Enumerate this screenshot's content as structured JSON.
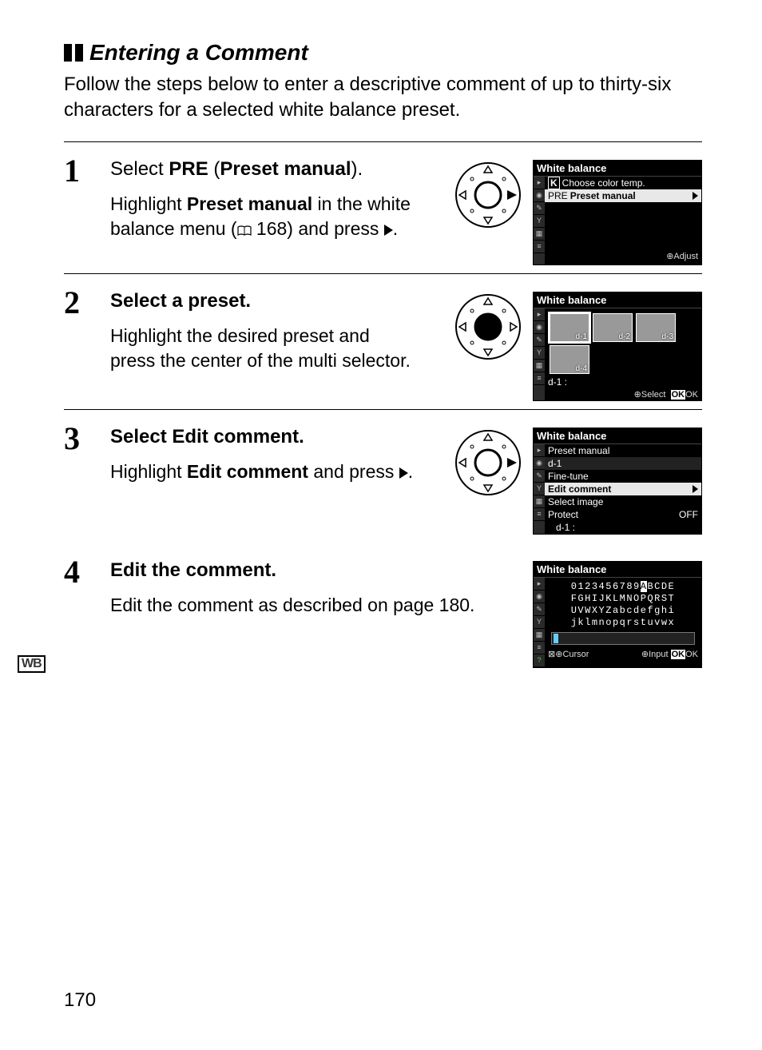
{
  "heading": "Entering a Comment",
  "intro": "Follow the steps below to enter a descriptive comment of up to thirty-six characters for a selected white balance preset.",
  "page_number": "170",
  "wb_badge": "WB",
  "steps": {
    "s1": {
      "num": "1",
      "title_pre": "Select ",
      "title_pre2": "PRE",
      "title_mid": " (",
      "title_bold": "Preset manual",
      "title_post": ").",
      "body_a": "Highlight ",
      "body_bold": "Preset manual",
      "body_b": " in the white balance menu (",
      "body_ref": " 168) and press ",
      "screen": {
        "title": "White balance",
        "row1_icon": "K",
        "row1": "Choose color temp.",
        "row2_pre": "PRE",
        "row2": "Preset manual",
        "footer": "Adjust"
      }
    },
    "s2": {
      "num": "2",
      "title": "Select a preset.",
      "body": "Highlight the desired preset and press the center of the multi selector.",
      "screen": {
        "title": "White balance",
        "d1": "d-1",
        "d2": "d-2",
        "d3": "d-3",
        "d4": "d-4",
        "label": "d-1 :",
        "footer_l": "Select",
        "footer_r": "OK"
      }
    },
    "s3": {
      "num": "3",
      "title_a": "Select ",
      "title_bold": "Edit comment",
      "title_b": ".",
      "body_a": "Highlight ",
      "body_bold": "Edit comment",
      "body_b": " and press ",
      "screen": {
        "title": "White balance",
        "r1": "Preset manual",
        "r2": "d-1",
        "r3": "Fine-tune",
        "r4": "Edit comment",
        "r5": "Select image",
        "r6": "Protect",
        "r6v": "OFF",
        "r7": "d-1 :"
      }
    },
    "s4": {
      "num": "4",
      "title": "Edit the comment.",
      "body": "Edit the comment as described on page 180.",
      "screen": {
        "title": "White balance",
        "line1a": "0123456789",
        "line1hl": "A",
        "line1b": "BCDE",
        "line2": "FGHIJKLMNOPQRST",
        "line3": "UVWXYZabcdefghi",
        "line4": "jklmnopqrstuvwx",
        "foot_cursor": "Cursor",
        "foot_input": "Input",
        "foot_ok": "OK"
      }
    }
  }
}
